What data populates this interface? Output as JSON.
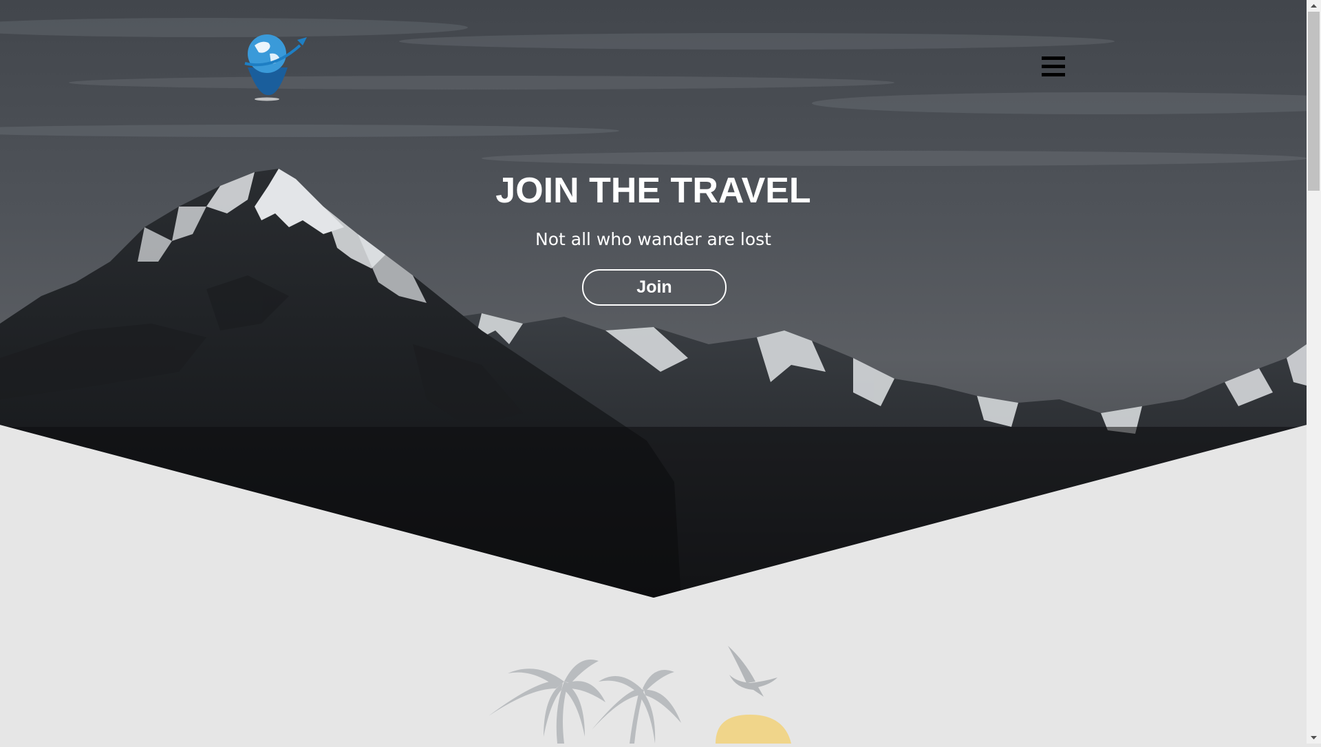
{
  "header": {
    "logo_name": "globe-plane-logo",
    "menu_icon": "hamburger-menu-icon"
  },
  "hero": {
    "title": "JOIN THE TRAVEL",
    "subtitle": "Not all who wander are lost",
    "join_label": "Join"
  },
  "illustration": {
    "name": "palm-trees-bird-sun-illustration"
  },
  "colors": {
    "page_background": "#e6e6e6",
    "hero_text": "#ffffff",
    "logo_blue": "#1e7fc4",
    "palm_gray": "#b9bcbf",
    "sun_yellow": "#f0d58a"
  }
}
